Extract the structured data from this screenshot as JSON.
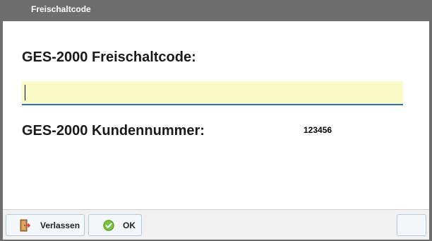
{
  "window": {
    "title": "Freischaltcode"
  },
  "form": {
    "code_label": "GES-2000 Freischaltcode:",
    "code_value": "",
    "customer_label": "GES-2000 Kundennummer:",
    "customer_value": "123456"
  },
  "footer": {
    "exit_label": "Verlassen",
    "ok_label": "OK"
  },
  "colors": {
    "titlebar": "#6e6e6e",
    "input_background": "#fbfbc8",
    "input_underline": "#2a6fb0",
    "ok_icon_green": "#7cc242"
  }
}
